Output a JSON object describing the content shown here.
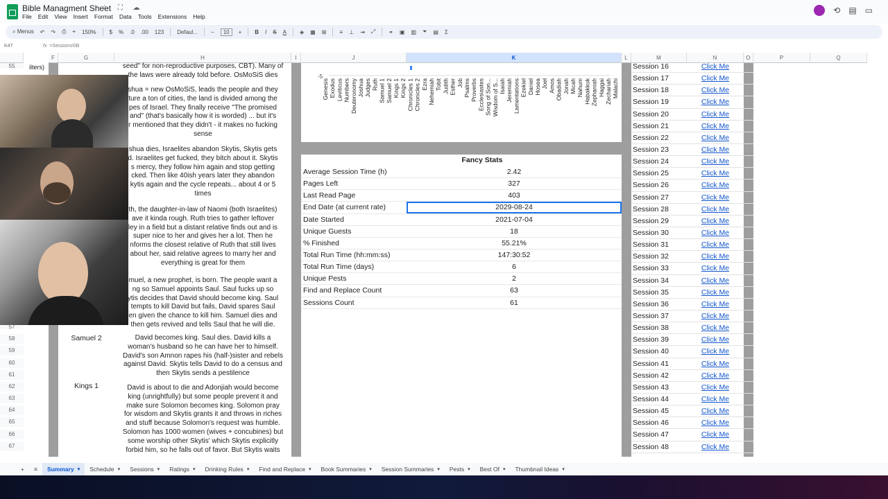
{
  "app": {
    "doc_title": "Bible Managment Sheet",
    "menu": [
      "File",
      "Edit",
      "View",
      "Insert",
      "Format",
      "Data",
      "Tools",
      "Extensions",
      "Help"
    ]
  },
  "toolbar": {
    "menus_label": "Menus",
    "zoom": "150%",
    "currency": "$",
    "percent": "%",
    "dec_less": ".0",
    "dec_more": ".00",
    "num_format": "123",
    "font": "Defaul...",
    "font_size": "10"
  },
  "formula_bar": {
    "cell_ref": "K47",
    "formula": "=Sessions!0B"
  },
  "columns": {
    "F": "F",
    "G": "G",
    "H": "H",
    "I": "I",
    "J": "J",
    "K": "K",
    "L": "L",
    "M": "M",
    "N": "N",
    "O": "O",
    "P": "P",
    "Q": "Q"
  },
  "rows_left": {
    "top_cell": "ilters)",
    "samuel2": "Samuel 2",
    "kings1": "Kings 1",
    "row_numbers": [
      "58",
      "59",
      "60",
      "61",
      "62",
      "63",
      "64",
      "65",
      "66",
      "67"
    ],
    "row_57": "57",
    "row_top": "55"
  },
  "summaries": {
    "block1": "seed\" for non-reproductive purposes, CBT). Many of\nthe laws were already told before. OsMoSiS dies",
    "block2": "shua = new OsMoSiS, leads the people and they\nture a ton of cities, the land is divided among the\npes of Israel. They finally receive \"The promised\nand\" (that's basically how it is worded) ... but it's\nr mentioned that they didn't - it makes no fucking\nsense",
    "block3": "shua dies, Israelites abandon Skytis, Skytis gets\nd. Israelites get fucked, they bitch about it. Skytis\ns mercy, they follow him again and stop getting\ncked. Then like 40ish years later they abandon\nkytis again and the cycle repeats... about 4 or 5\ntimes",
    "block4": "th, the daughter-in-law of Naomi (both Israelites)\nave it kinda rough. Ruth tries to gather leftover\nley in a field but a distant relative finds out and is\nsuper nice to her and gives her a lot. Then he\nnforms the closest relative of Ruth that still lives\nabout her, said relative agrees to marry her and\neverything is great for them",
    "block5": "muel, a new prophet, is born. The people want a\nng so Samuel appoints Saul. Saul fucks up so\nytis decides that David should become king. Saul\ntempts to kill David but fails, David spares Saul\nen given the chance to kill him. Samuel dies and\nthen gets revived and tells Saul that he will die.",
    "block6": "David becomes king. Saul dies. David kills a\nwoman's husband so he can have her to himself.\nDavid's son Amnon rapes his (half-)sister and rebels\nagainst David. Skytis tells David to do a census and\nthen Skytis sends a pestilence",
    "block7": "David is about to die and Adonjiah would become\nking (unrightfully) but some people prevent it and\nmake sure Solomon becomes king. Solomon pray\nfor wisdom and Skytis grants it and throws in riches\nand stuff because Solomon's request was humble.\nSolomon has 1000 women (wives + concubines) but\nsome worship other Skytis' which Skytis explicitly\nforbid him, so he falls out of favor. But Skytis waits"
  },
  "chart_data": {
    "type": "bar",
    "categories": [
      "Genesis",
      "Exodus",
      "Leviticus",
      "Numbers",
      "Deuteronomy",
      "Joshua",
      "Judges",
      "Ruth",
      "Samuel 1",
      "Samuel 2",
      "Kings 1",
      "Kings 2",
      "Chronicles 1",
      "Chronicles 2",
      "Ezra",
      "Nehemiah",
      "Tobit",
      "Judith",
      "Esther",
      "Job",
      "Psalms",
      "Proverbs",
      "Ecclesiastes",
      "Song of Son...",
      "Wisdom of S...",
      "Isaiah",
      "Jeremiah",
      "Lamentations",
      "Ezekiel",
      "Daniel",
      "Hosea",
      "Joel",
      "Amos",
      "Obadiah",
      "Jonah",
      "Micah",
      "Nahum",
      "Habakkuk",
      "Zephaniah",
      "Haggai",
      "Zechariah",
      "Malachi"
    ],
    "y_tick": "-5"
  },
  "stats": {
    "title": "Fancy Stats",
    "rows": [
      {
        "label": "Average Session Time (h)",
        "value": "2.42"
      },
      {
        "label": "Pages Left",
        "value": "327"
      },
      {
        "label": "Last Read Page",
        "value": "403"
      },
      {
        "label": "End Date (at current rate)",
        "value": "2029-08-24"
      },
      {
        "label": "Date Started",
        "value": "2021-07-04"
      },
      {
        "label": "Unique Guests",
        "value": "18"
      },
      {
        "label": "% Finished",
        "value": "55.21%"
      },
      {
        "label": "Total Run Time (hh:mm:ss)",
        "value": "147:30:52"
      },
      {
        "label": "Total Run Time (days)",
        "value": "6"
      },
      {
        "label": "Unique Pests",
        "value": "2"
      },
      {
        "label": "Find and Replace Count",
        "value": "63"
      },
      {
        "label": "Sessions Count",
        "value": "61"
      }
    ]
  },
  "sessions": {
    "link_label": "Click Me",
    "rows": [
      "Session 16",
      "Session 17",
      "Session 18",
      "Session 19",
      "Session 20",
      "Session 21",
      "Session 22",
      "Session 23",
      "Session 24",
      "Session 25",
      "Session 26",
      "Session 27",
      "Session 28",
      "Session 29",
      "Session 30",
      "Session 31",
      "Session 32",
      "Session 33",
      "Session 34",
      "Session 35",
      "Session 36",
      "Session 37",
      "Session 38",
      "Session 39",
      "Session 40",
      "Session 41",
      "Session 42",
      "Session 43",
      "Session 44",
      "Session 45",
      "Session 46",
      "Session 47",
      "Session 48"
    ]
  },
  "sheet_tabs": [
    "Summary",
    "Schedule",
    "Sessions",
    "Ratings",
    "Drinking Rules",
    "Find and Replace",
    "Book Summaries",
    "Session Summaries",
    "Pests",
    "Best Of",
    "Thumbnail Ideas"
  ]
}
